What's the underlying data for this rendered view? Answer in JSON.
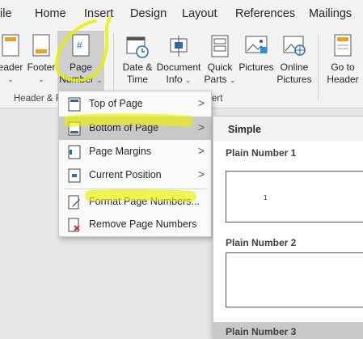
{
  "tabs": [
    "ile",
    "Home",
    "Insert",
    "Design",
    "Layout",
    "References",
    "Mailings"
  ],
  "ribbon": {
    "header_label": "eader",
    "footer_label": "Footer",
    "page_number_label_1": "Page",
    "page_number_label_2": "Number",
    "date_time_1": "Date &",
    "date_time_2": "Time",
    "doc_info_1": "Document",
    "doc_info_2": "Info",
    "quick_parts_1": "Quick",
    "quick_parts_2": "Parts",
    "pictures_1": "Pictures",
    "online_pictures_1": "Online",
    "online_pictures_2": "Pictures",
    "goto_header_1": "Go to",
    "goto_header_2": "Header",
    "group_hf": "Header & F",
    "group_insert": "ert",
    "caret": "⌄"
  },
  "menu": {
    "items": [
      {
        "label": "Top of Page",
        "submenu": true
      },
      {
        "label": "Bottom of Page",
        "submenu": true
      },
      {
        "label": "Page Margins",
        "submenu": true
      },
      {
        "label": "Current Position",
        "submenu": true
      },
      {
        "label": "Format Page Numbers...",
        "submenu": false
      },
      {
        "label": "Remove Page Numbers",
        "submenu": false
      }
    ],
    "arrow": ">"
  },
  "gallery": {
    "heading": "Simple",
    "items": [
      {
        "title": "Plain Number 1",
        "number": "1"
      },
      {
        "title": "Plain Number 2",
        "number": ""
      },
      {
        "title": "Plain Number 3",
        "number": ""
      }
    ]
  },
  "colors": {
    "highlighter": "#e8f000",
    "accent_blue": "#2b6cb0",
    "hover_grey": "#c8c8c8"
  }
}
